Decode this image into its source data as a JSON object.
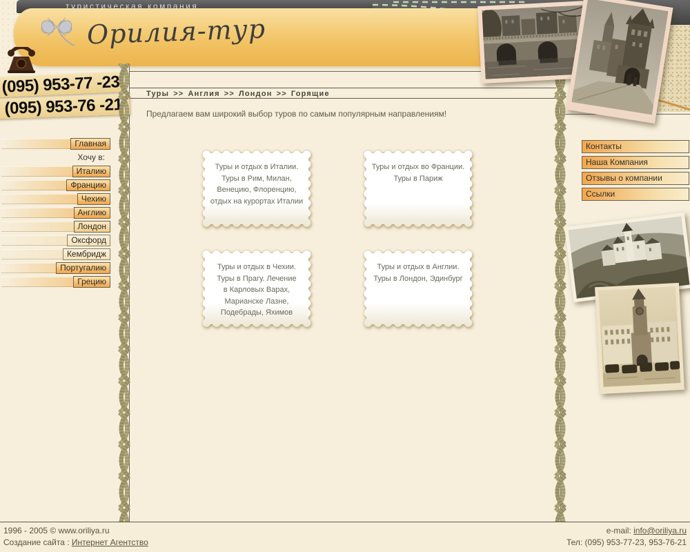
{
  "colors": {
    "accent_orange": "#F2A84D",
    "gold_band": "#EFC263",
    "dark_band": "#3E3E3E",
    "cream_background": "#F7EFDC",
    "rope_olive": "#ACA478"
  },
  "header": {
    "tagline": "туристическая компания",
    "logo_text": "Орилия-тур",
    "logo_icon": "four-leaf-clover-icon",
    "phone_icon": "retro-telephone-icon",
    "phones": [
      "(095) 953-77 -23",
      "(095) 953-76 -21"
    ]
  },
  "left_menu": {
    "items": [
      {
        "label": "Главная"
      },
      {
        "label": "Хочу в:"
      },
      {
        "label": "Италию"
      },
      {
        "label": "Францию"
      },
      {
        "label": "Чехию"
      },
      {
        "label": "Англию"
      },
      {
        "label": "Лондон"
      },
      {
        "label": "Оксфорд"
      },
      {
        "label": "Кембридж"
      },
      {
        "label": "Португалию"
      },
      {
        "label": "Грецию"
      }
    ]
  },
  "breadcrumb": {
    "items": [
      "Туры",
      "Англия",
      "Лондон",
      "Горящие"
    ],
    "separator": ">>"
  },
  "main": {
    "intro": "Предлагаем вам широкий выбор туров по самым популярным  направлениям!",
    "cards": [
      {
        "text": "Туры и отдых в Италии.\nТуры в Рим, Милан,\nВенецию, Флоренцию,\nотдых на курортах Италии"
      },
      {
        "text": "Туры и отдых во Франции.\nТуры в Париж"
      },
      {
        "text": "Туры и отдых в Чехии.\nТуры в Прагу. Лечение\nв Карловых Варах,\nМарианске Лазне,\nПодебрады, Яхимов"
      },
      {
        "text": "Туры и отдых в Англии.\nТуры в Лондон, Эдинбург"
      }
    ]
  },
  "right_menu": {
    "items": [
      {
        "label": "Контакты"
      },
      {
        "label": "Наша Компания"
      },
      {
        "label": "Отзывы о компании"
      },
      {
        "label": "Ссылки"
      }
    ]
  },
  "photos": [
    {
      "name": "vintage-photo-bridge-over-river"
    },
    {
      "name": "vintage-photo-old-town-tower"
    },
    {
      "name": "vintage-photo-castle-on-hill"
    },
    {
      "name": "vintage-photo-kremlin-tower-street"
    }
  ],
  "footer": {
    "copyright": "1996 - 2005 © www.oriliya.ru",
    "site_by_label": "Создание сайта :",
    "site_by_link": "Интернет Агентство",
    "email_label": "e-mail:",
    "email_link": "info@oriliya.ru",
    "phones_line": "Тел: (095) 953-77-23, 953-76-21"
  }
}
